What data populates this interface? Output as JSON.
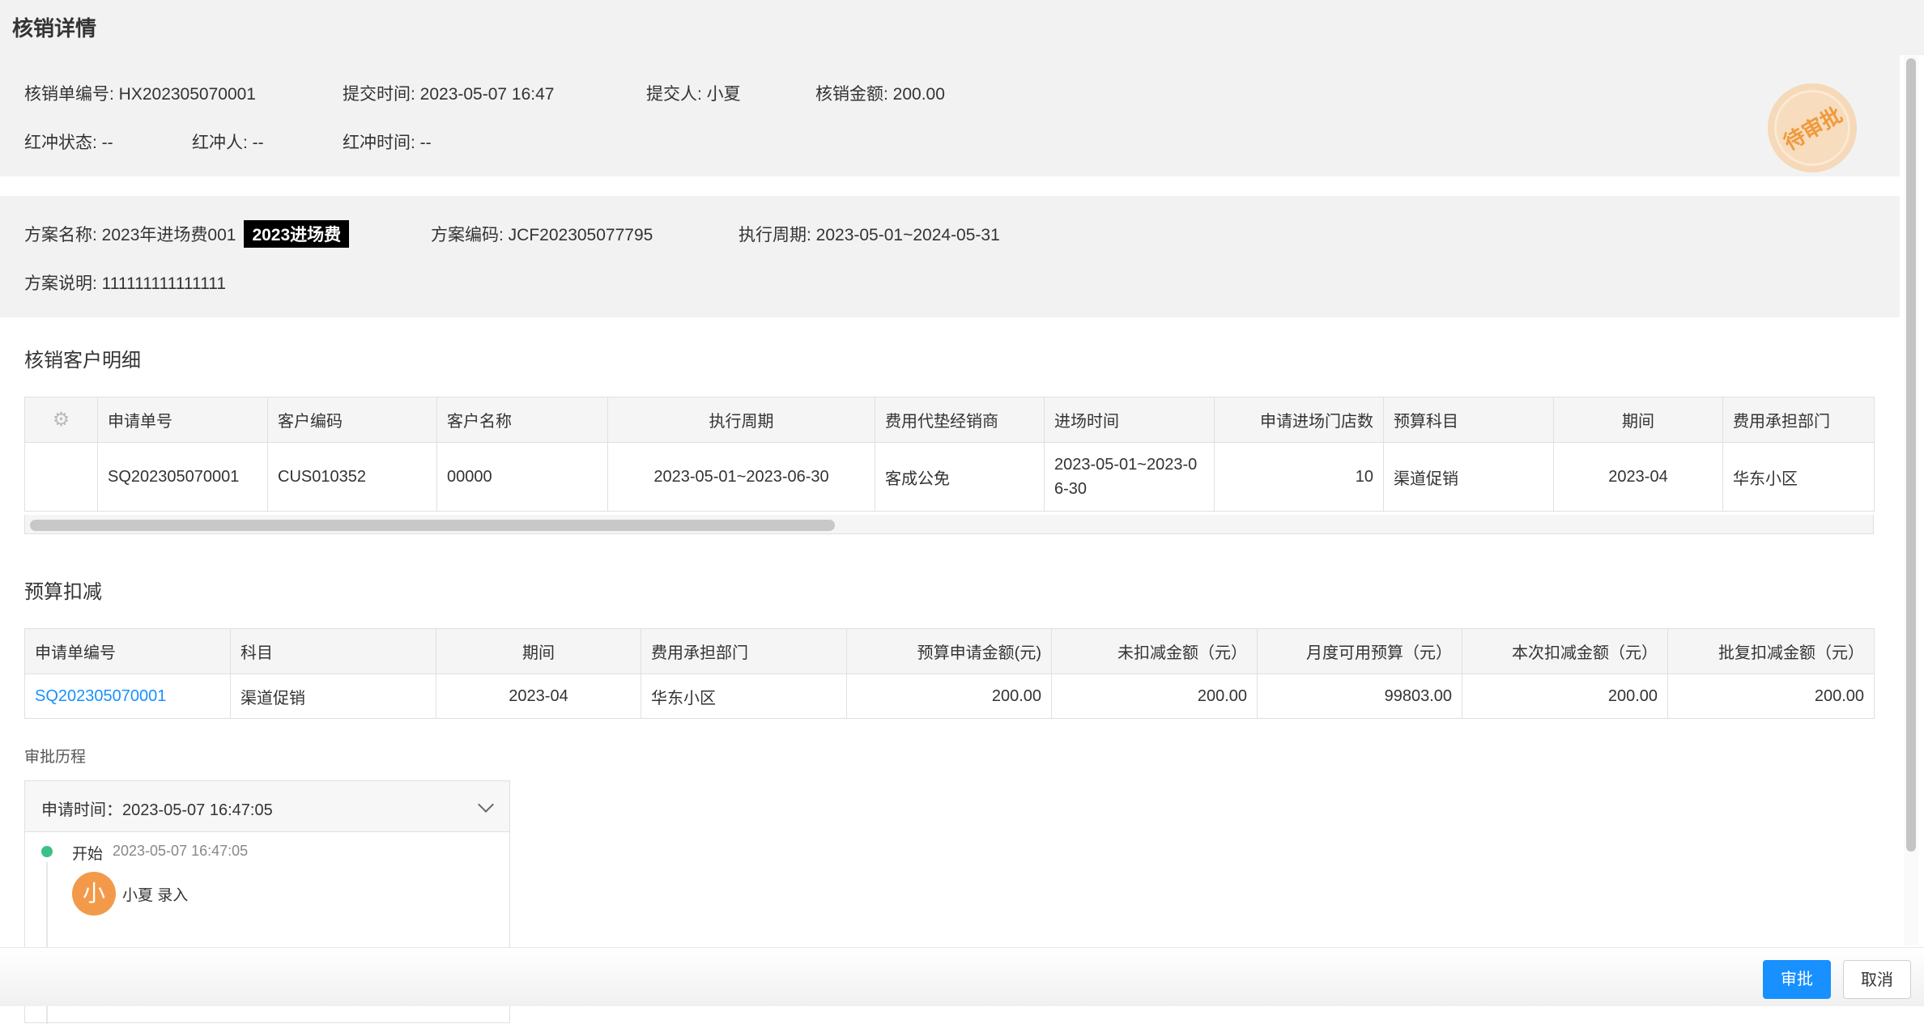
{
  "dialog": {
    "title": "核销详情"
  },
  "info": {
    "order_no": "核销单编号: HX202305070001",
    "submit_time": "提交时间: 2023-05-07 16:47",
    "submitter": "提交人: 小夏",
    "amount": "核销金额: 200.00",
    "red_status": "红冲状态: --",
    "red_person": "红冲人: --",
    "red_time": "红冲时间: --"
  },
  "stamp": {
    "text": "待审批",
    "color": "#f09a3c"
  },
  "plan": {
    "name": "方案名称: 2023年进场费001",
    "tag": "2023进场费",
    "code": "方案编码: JCF202305077795",
    "period": "执行周期: 2023-05-01~2024-05-31",
    "desc": "方案说明: 111111111111111"
  },
  "customer_section": {
    "title": "核销客户明细",
    "settings_icon": "gear-icon",
    "columns": [
      "申请单号",
      "客户编码",
      "客户名称",
      "执行周期",
      "费用代垫经销商",
      "进场时间",
      "申请进场门店数",
      "预算科目",
      "期间",
      "费用承担部门"
    ],
    "rows": [
      [
        "SQ202305070001",
        "CUS010352",
        "00000",
        "2023-05-01~2023-06-30",
        "客成公免",
        "2023-05-01~2023-06-30",
        "10",
        "渠道促销",
        "2023-04",
        "华东小区"
      ]
    ]
  },
  "budget_section": {
    "title": "预算扣减",
    "columns": [
      "申请单编号",
      "科目",
      "期间",
      "费用承担部门",
      "预算申请金额(元)",
      "未扣减金额（元）",
      "月度可用预算（元）",
      "本次扣减金额（元）",
      "批复扣减金额（元）"
    ],
    "rows": [
      [
        "SQ202305070001",
        "渠道促销",
        "2023-04",
        "华东小区",
        "200.00",
        "200.00",
        "99803.00",
        "200.00",
        "200.00"
      ]
    ]
  },
  "approval": {
    "title": "审批历程",
    "apply_time": "申请时间：2023-05-07 16:47:05",
    "step_name": "开始",
    "step_time": "2023-05-07 16:47:05",
    "avatar_char": "小",
    "action": "小夏 录入",
    "dot_color": "#3cc08a",
    "avatar_color": "#f39a4a"
  },
  "footer": {
    "approve_label": "审批",
    "cancel_label": "取消",
    "primary_color": "#1890ff"
  }
}
